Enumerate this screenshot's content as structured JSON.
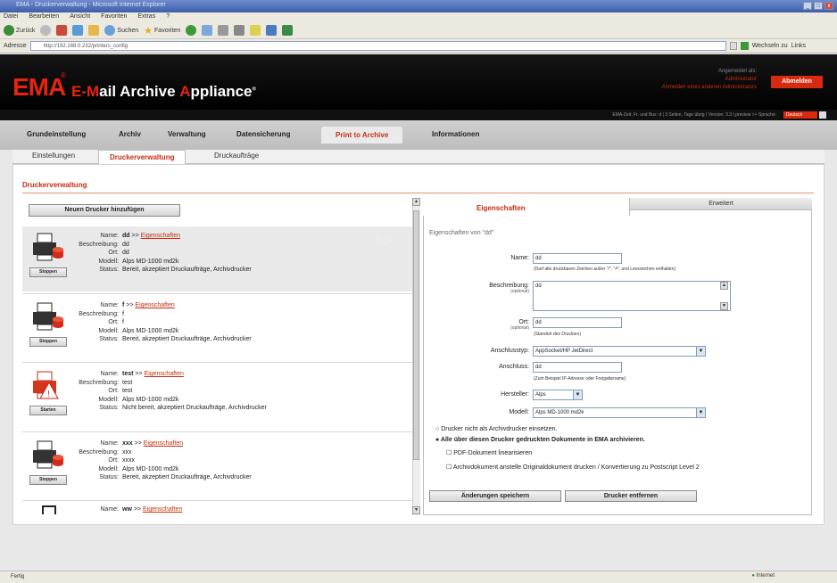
{
  "browser": {
    "title": "EMA - Druckerverwaltung - Microsoft Internet Explorer",
    "menu": [
      "Datei",
      "Bearbeiten",
      "Ansicht",
      "Favoriten",
      "Extras",
      "?"
    ],
    "toolbar": {
      "back": "Zurück",
      "search": "Suchen",
      "favorites": "Favoriten"
    },
    "address_label": "Adresse",
    "address_value": "http://192.168.0.232/printers_config",
    "go_label": "Wechseln zu",
    "links_label": "Links",
    "status_left": "Fertig",
    "status_right": "Internet"
  },
  "header": {
    "logo": "EMA",
    "logo_reg": "®",
    "product_prefix": "E-",
    "product_m": "M",
    "product_mid": "ail Archive ",
    "product_a": "A",
    "product_end": "ppliance",
    "product_tm": "®",
    "logged_in_label": "Angemeldet als:",
    "user": "Administrator",
    "user_link": "Anmelden eines anderen Administrators",
    "logout": "Abmelden",
    "subheader_info": "EMA-Zeit: Fr. und Bus: d | 3 Seiten, Tage übrig | Version: 3.3 | preview >> Sprache:",
    "language": "Deutsch"
  },
  "nav": {
    "tabs": [
      "Grundeinstellung",
      "Archiv",
      "Verwaltung",
      "Datensicherung",
      "Print to Archive",
      "Informationen"
    ],
    "active": "Print to Archive"
  },
  "subnav": {
    "tabs": [
      "Einstellungen",
      "Druckerverwaltung",
      "Druckaufträge"
    ],
    "active": "Druckerverwaltung"
  },
  "page": {
    "title": "Druckerverwaltung",
    "add_button": "Neuen Drucker hinzufügen",
    "labels": {
      "name": "Name:",
      "description": "Beschreibung:",
      "location": "Ort:",
      "model": "Modell:",
      "status": "Status:"
    },
    "props_link": "Eigenschaften",
    "printers": [
      {
        "name": "dd",
        "desc": "dd",
        "loc": "dd",
        "model": "Alps MD-1000 md2k",
        "status": "Bereit, akzeptiert Druckaufträge, Archivdrucker",
        "button": "Stoppen"
      },
      {
        "name": "f",
        "desc": "f",
        "loc": "f",
        "model": "Alps MD-1000 md2k",
        "status": "Bereit, akzeptiert Druckaufträge, Archivdrucker",
        "button": "Stoppen"
      },
      {
        "name": "test",
        "desc": "test",
        "loc": "test",
        "model": "Alps MD-1000 md2k",
        "status": "Nicht bereit, akzeptiert Druckaufträge, Archivdrucker",
        "button": "Starten"
      },
      {
        "name": "xxx",
        "desc": "xxx",
        "loc": "xxxx",
        "model": "Alps MD-1000 md2k",
        "status": "Bereit, akzeptiert Druckaufträge, Archivdrucker",
        "button": "Stoppen"
      },
      {
        "name": "ww",
        "desc": "",
        "loc": "",
        "model": "",
        "status": "",
        "button": ""
      }
    ]
  },
  "props": {
    "tab_active": "Eigenschaften",
    "tab_other": "Erweitert",
    "subtitle": "Eigenschaften von \"dd\"",
    "name_label": "Name:",
    "name_value": "dd",
    "name_hint": "(Darf alle druckbaren Zeichen außer \"/\", \"#\", und Leerzeichen enthalten)",
    "desc_label": "Beschreibung:",
    "desc_small": "(optional)",
    "desc_value": "dd",
    "loc_label": "Ort:",
    "loc_small": "(optional)",
    "loc_value": "dd",
    "loc_hint": "(Standort des Druckers)",
    "conn_type_label": "Anschlusstyp:",
    "conn_type_value": "AppSocket/HP JetDirect",
    "conn_label": "Anschluss:",
    "conn_value": "dd",
    "conn_hint": "(Zum Beispiel IP-Adresse oder Freigabename)",
    "maker_label": "Hersteller:",
    "maker_value": "Alps",
    "model_label": "Modell:",
    "model_value": "Alps MD-1000 md2k",
    "radio1": "Drucker nicht als Archivdrucker einsetzen.",
    "radio2": "Alle über diesen Drucker gedruckten Dokumente in EMA archivieren.",
    "check1": "PDF-Dokument linearisieren",
    "check2": "Archivdokument anstelle Originaldokument drucken / Konvertierung zu Postscript Level 2",
    "save_button": "Änderungen speichern",
    "delete_button": "Drucker entfernen"
  }
}
